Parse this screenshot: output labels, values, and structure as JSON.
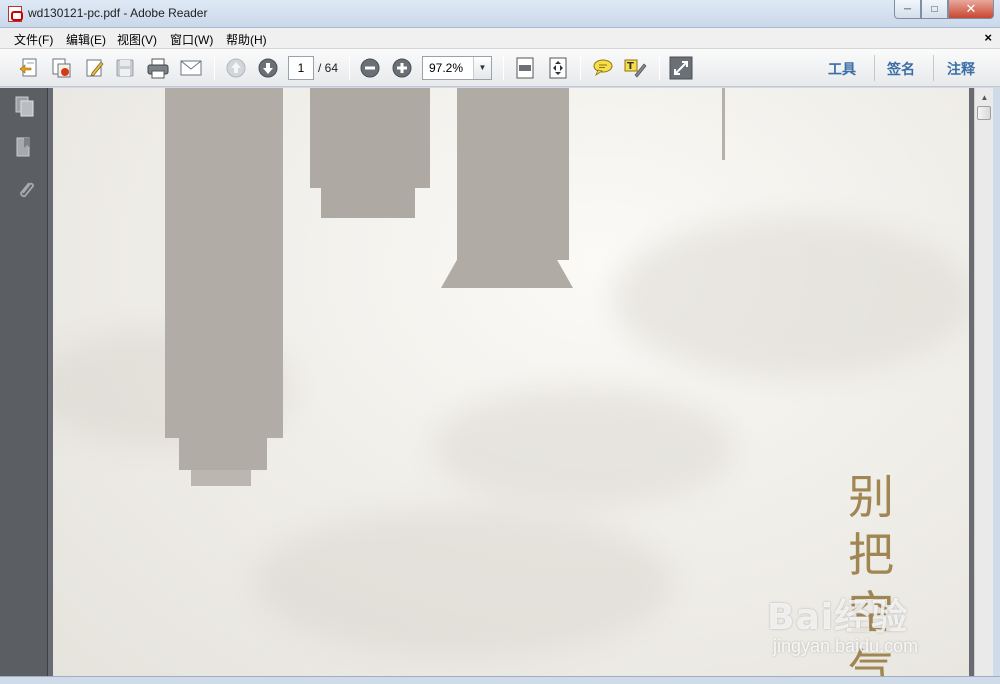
{
  "window": {
    "title": "wd130121-pc.pdf - Adobe Reader",
    "buttons": {
      "minimize": "─",
      "maximize": "□",
      "close": "✕"
    }
  },
  "menu": {
    "items": [
      "文件(F)",
      "编辑(E)",
      "视图(V)",
      "窗口(W)",
      "帮助(H)"
    ],
    "close_doc": "×"
  },
  "toolbar": {
    "page_current": "1",
    "page_total": "/ 64",
    "zoom": "97.2%",
    "zoom_arrow": "▼",
    "panes": [
      "工具",
      "签名",
      "注释"
    ],
    "icons": [
      "create-pdf-icon",
      "combine-icon",
      "edit-icon",
      "save-icon",
      "print-icon",
      "email-icon",
      "prev-page-icon",
      "next-page-icon",
      "zoom-out-icon",
      "zoom-in-icon",
      "fit-page-icon",
      "fit-width-icon",
      "comment-icon",
      "highlight-icon",
      "fullscreen-icon"
    ]
  },
  "nav": {
    "icons": [
      "page-thumbnails-icon",
      "bookmarks-icon",
      "attachments-icon"
    ]
  },
  "document": {
    "vertical_text": [
      "别",
      "把",
      "空",
      "气"
    ],
    "watermark": "Bai经验",
    "watermark_sub": "jingyan.baidu.com"
  }
}
